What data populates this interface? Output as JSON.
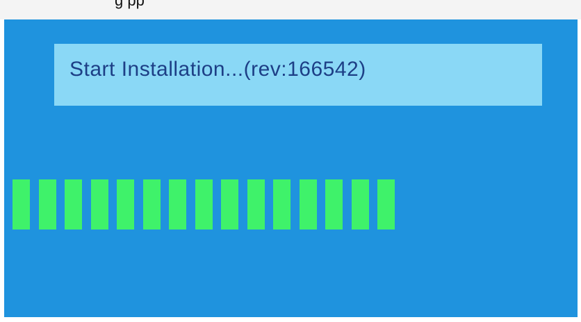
{
  "header_strip": {
    "text": "g       pp"
  },
  "installer": {
    "message": "Start Installation...(rev:166542)"
  },
  "progress": {
    "filled_blocks": 15,
    "fill_fraction": 0.52
  },
  "colors": {
    "screen_background": "#1f93de",
    "message_box": "#8ad8f6",
    "message_text": "#1d3f86",
    "progress_block": "#3ff26a"
  }
}
